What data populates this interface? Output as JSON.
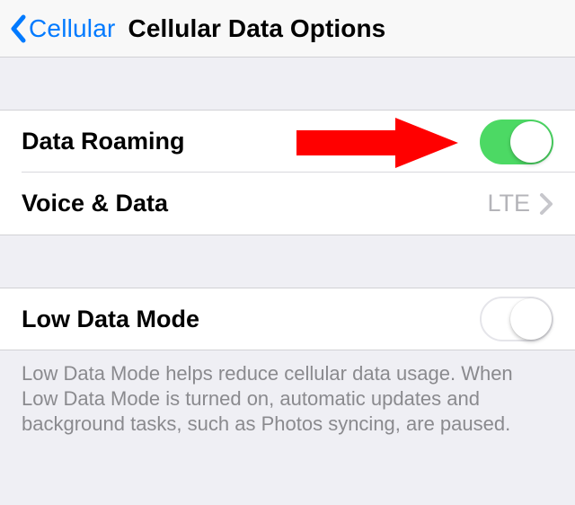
{
  "nav": {
    "back_label": "Cellular",
    "title": "Cellular Data Options"
  },
  "group1": {
    "roaming": {
      "label": "Data Roaming",
      "toggle_on": true
    },
    "voice_data": {
      "label": "Voice & Data",
      "value": "LTE"
    }
  },
  "group2": {
    "low_data": {
      "label": "Low Data Mode",
      "toggle_on": false
    },
    "footer": "Low Data Mode helps reduce cellular data usage. When Low Data Mode is turned on, automatic updates and background tasks, such as Photos syncing, are paused."
  },
  "annotation": {
    "arrow_color": "#ff0000"
  }
}
